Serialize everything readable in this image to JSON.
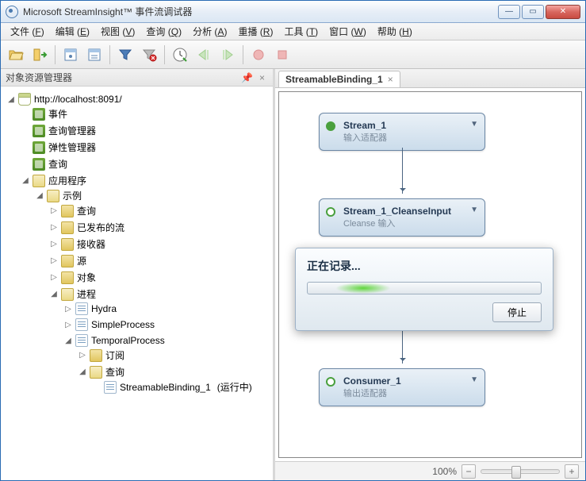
{
  "window": {
    "title": "Microsoft StreamInsight™ 事件流调试器"
  },
  "menu": [
    {
      "label": "文件",
      "key": "F"
    },
    {
      "label": "编辑",
      "key": "E"
    },
    {
      "label": "视图",
      "key": "V"
    },
    {
      "label": "查询",
      "key": "Q"
    },
    {
      "label": "分析",
      "key": "A"
    },
    {
      "label": "重播",
      "key": "R"
    },
    {
      "label": "工具",
      "key": "T"
    },
    {
      "label": "窗口",
      "key": "W"
    },
    {
      "label": "帮助",
      "key": "H"
    }
  ],
  "left_pane": {
    "title": "对象资源管理器",
    "root": "http://localhost:8091/",
    "top_children": [
      "事件",
      "查询管理器",
      "弹性管理器",
      "查询"
    ],
    "apps": "应用程序",
    "sample": "示例",
    "sample_children": [
      "查询",
      "已发布的流",
      "接收器",
      "源",
      "对象"
    ],
    "proc": "进程",
    "proc_children": [
      "Hydra",
      "SimpleProcess"
    ],
    "temporal": "TemporalProcess",
    "temporal_children": [
      "订阅"
    ],
    "temporal_query": "查询",
    "binding": "StreamableBinding_1",
    "binding_suffix": "(运行中)"
  },
  "tab": {
    "label": "StreamableBinding_1"
  },
  "diagram": {
    "n1": {
      "title": "Stream_1",
      "sub": "输入适配器"
    },
    "n2": {
      "title": "Stream_1_CleanseInput",
      "sub": "Cleanse 输入"
    },
    "n3": {
      "title": "Consumer_1",
      "sub": "输出适配器"
    }
  },
  "modal": {
    "title": "正在记录...",
    "stop": "停止"
  },
  "status": {
    "zoom": "100%"
  }
}
